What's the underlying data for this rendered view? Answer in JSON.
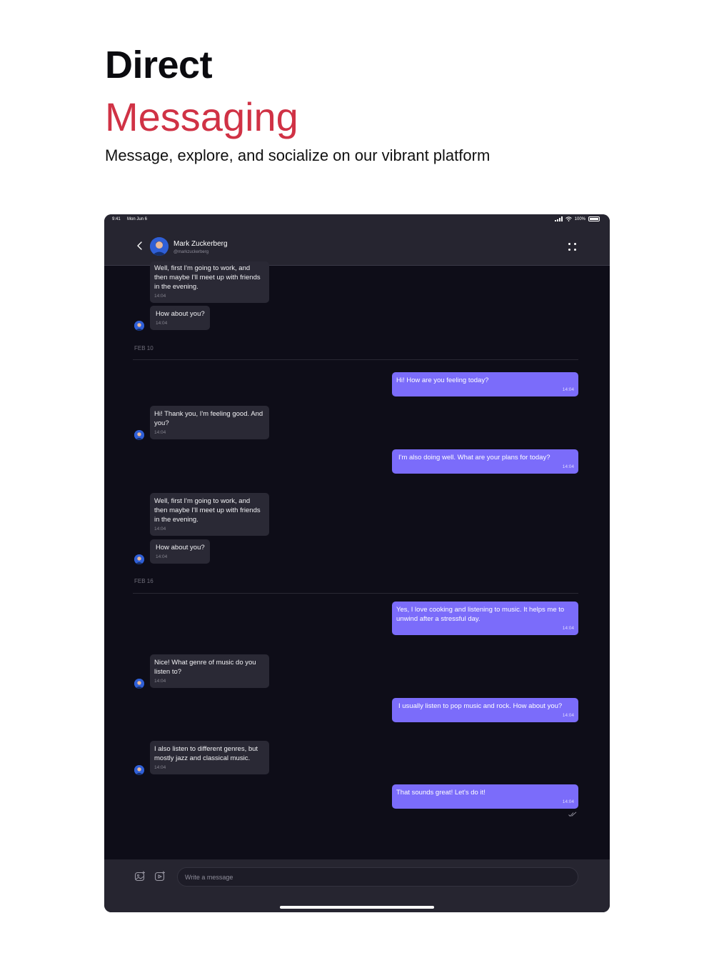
{
  "promo": {
    "title_line1": "Direct",
    "title_line2": "Messaging",
    "subtitle": "Message, explore, and socialize on our vibrant platform"
  },
  "status_bar": {
    "time": "9:41",
    "date": "Mon Jun 6",
    "battery": "100%"
  },
  "header": {
    "contact_name": "Mark Zuckerberg",
    "contact_handle": "@markzuckerberg"
  },
  "messages": [
    {
      "direction": "in",
      "text": "Well, first I'm going to work, and then maybe I'll meet up with friends in the evening.",
      "time": "14:04"
    },
    {
      "direction": "in",
      "text": "How about you?",
      "time": "14:04"
    },
    {
      "type": "date",
      "label": "FEB 10"
    },
    {
      "direction": "out",
      "text": "Hi! How are you feeling today?",
      "time": "14:04"
    },
    {
      "direction": "in",
      "text": "Hi! Thank you, I'm feeling good. And you?",
      "time": "14:04"
    },
    {
      "direction": "out",
      "text": "I'm also doing well. What are your plans for today?",
      "time": "14:04"
    },
    {
      "direction": "in",
      "text": "Well, first I'm going to work, and then maybe I'll meet up with friends in the evening.",
      "time": "14:04"
    },
    {
      "direction": "in",
      "text": "How about you?",
      "time": "14:04"
    },
    {
      "type": "date",
      "label": "FEB 16"
    },
    {
      "direction": "out",
      "text": "Yes, I love cooking and listening to music. It helps me to unwind after a stressful day.",
      "time": "14:04"
    },
    {
      "direction": "in",
      "text": "Nice! What genre of music do you listen to?",
      "time": "14:04"
    },
    {
      "direction": "out",
      "text": "I usually listen to pop music and rock. How about you?",
      "time": "14:04"
    },
    {
      "direction": "in",
      "text": "I also listen to different genres, but mostly jazz and classical music.",
      "time": "14:04"
    },
    {
      "direction": "out",
      "text": "That sounds great! Let's do it!",
      "time": "14:04"
    }
  ],
  "composer": {
    "placeholder": "Write a message"
  },
  "colors": {
    "accent": "#7b6cfa",
    "brand_red": "#d03245",
    "background": "#0e0d18",
    "incoming_bubble": "#2a2935"
  }
}
